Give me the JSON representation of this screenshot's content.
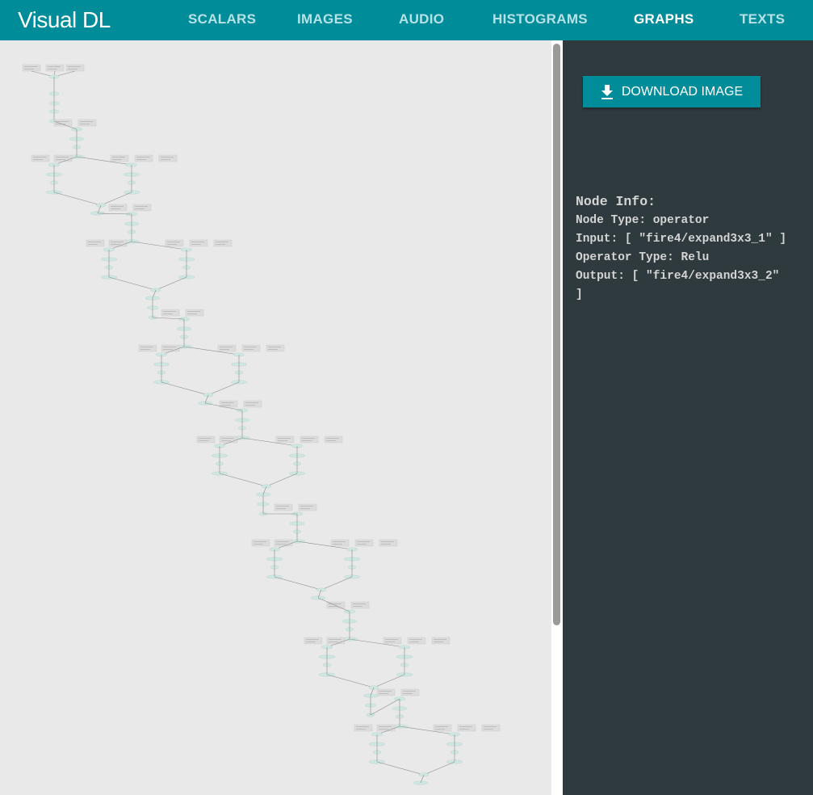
{
  "app": {
    "logo": "Visual DL"
  },
  "nav": {
    "items": [
      {
        "label": "SCALARS"
      },
      {
        "label": "IMAGES"
      },
      {
        "label": "AUDIO"
      },
      {
        "label": "HISTOGRAMS"
      },
      {
        "label": "GRAPHS",
        "active": true
      },
      {
        "label": "TEXTS"
      }
    ]
  },
  "download": {
    "label": "DOWNLOAD IMAGE",
    "icon": "download-icon"
  },
  "node_info": {
    "title": "Node Info:",
    "node_type": "Node Type: operator",
    "input": "Input: [ \"fire4/expand3x3_1\" ]",
    "operator_type": "Operator Type: Relu",
    "output_line1": "Output: [ \"fire4/expand3x3_2\"",
    "output_line2": "]"
  },
  "colors": {
    "header": "#008c99",
    "nav_inactive": "#b6e2e6",
    "nav_active": "#ffffff",
    "panel_bg": "#2f3a3e",
    "graph_bg": "#e9e9e9",
    "node_fill": "#cfe7e2",
    "edge": "#8a8a8a"
  }
}
